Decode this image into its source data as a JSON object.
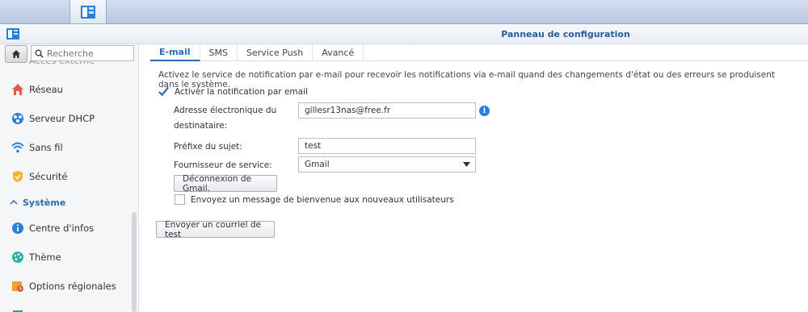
{
  "window": {
    "title": "Panneau de configuration"
  },
  "sidebar": {
    "search_placeholder": "Recherche",
    "partial_item": "Accès externe",
    "items": [
      {
        "label": "Réseau",
        "icon": "network-icon"
      },
      {
        "label": "Serveur DHCP",
        "icon": "dhcp-icon"
      },
      {
        "label": "Sans fil",
        "icon": "wifi-icon"
      },
      {
        "label": "Sécurité",
        "icon": "shield-icon"
      }
    ],
    "section": "Système",
    "system_items": [
      {
        "label": "Centre d'infos",
        "icon": "info-icon"
      },
      {
        "label": "Thème",
        "icon": "palette-icon"
      },
      {
        "label": "Options régionales",
        "icon": "regional-icon"
      }
    ]
  },
  "tabs": [
    "E-mail",
    "SMS",
    "Service Push",
    "Avancé"
  ],
  "active_tab": "E-mail",
  "email": {
    "description": "Activez le service de notification par e-mail pour recevoir les notifications via e-mail quand des changements d'état ou des erreurs se produisent dans le système.",
    "enable_label": "Activer la notification par email",
    "enable_checked": true,
    "recipient_label_1": "Adresse électronique du",
    "recipient_label_2": "destinataire:",
    "recipient_value": "gillesr13nas@free.fr",
    "prefix_label": "Préfixe du sujet:",
    "prefix_value": "test",
    "provider_label": "Fournisseur de service:",
    "provider_value": "Gmail",
    "disconnect_button": "Déconnexion de Gmail.",
    "welcome_label": "Envoyez un message de bienvenue aux nouveaux utilisateurs",
    "welcome_checked": false,
    "test_button": "Envoyer un courriel de test"
  },
  "colors": {
    "accent": "#2a6bb0",
    "title": "#2a5d9a"
  }
}
